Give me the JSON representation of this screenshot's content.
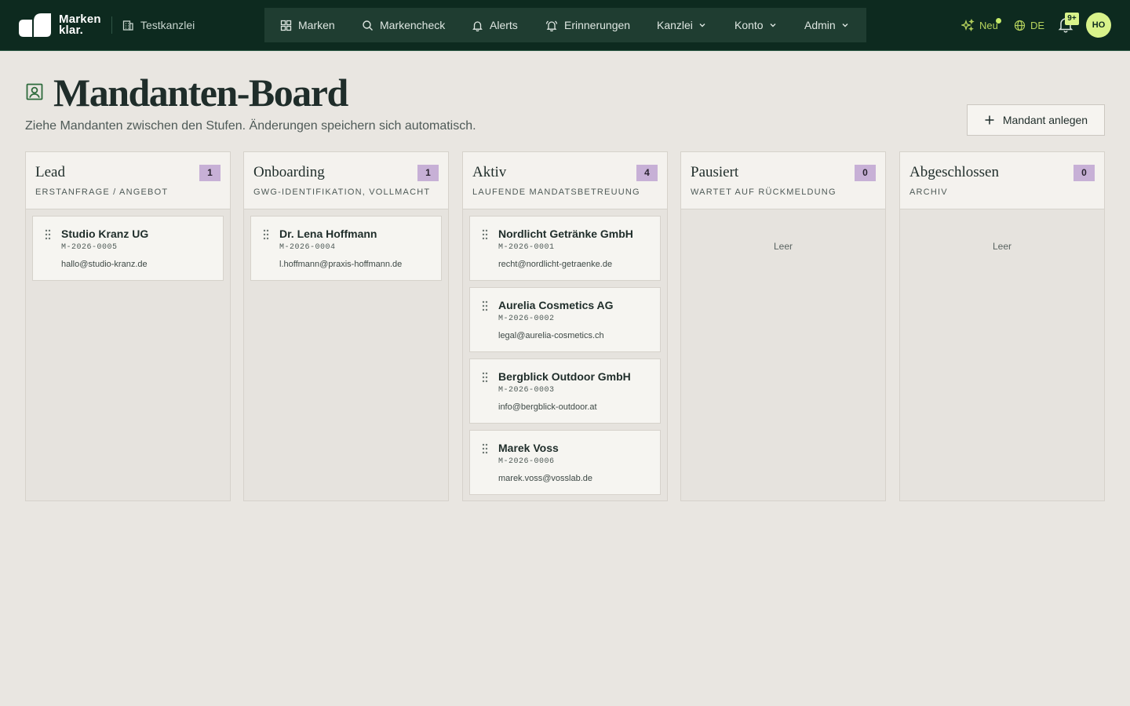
{
  "app": {
    "logo_line1": "Marken",
    "logo_line2": "klar.",
    "tenant": "Testkanzlei"
  },
  "nav": {
    "items": [
      {
        "label": "Marken",
        "icon": "grid-icon"
      },
      {
        "label": "Markencheck",
        "icon": "search-icon"
      },
      {
        "label": "Alerts",
        "icon": "bell-icon"
      },
      {
        "label": "Erinnerungen",
        "icon": "bell-ring-icon"
      },
      {
        "label": "Kanzlei",
        "icon": "chevron-down-icon"
      },
      {
        "label": "Konto",
        "icon": "chevron-down-icon"
      },
      {
        "label": "Admin",
        "icon": "chevron-down-icon"
      }
    ]
  },
  "topbar": {
    "new_label": "Neu",
    "lang_label": "DE",
    "notifications_badge": "9+",
    "avatar_initials": "HO"
  },
  "page": {
    "title": "Mandanten-Board",
    "subtitle": "Ziehe Mandanten zwischen den Stufen. Änderungen speichern sich automatisch.",
    "add_button": "Mandant anlegen"
  },
  "board": {
    "columns": [
      {
        "title": "Lead",
        "subtitle": "Erstanfrage / Angebot",
        "count": "1",
        "empty_label": "",
        "cards": [
          {
            "name": "Studio Kranz UG",
            "code": "M-2026-0005",
            "email": "hallo@studio-kranz.de"
          }
        ]
      },
      {
        "title": "Onboarding",
        "subtitle": "GwG-Identifikation, Vollmacht",
        "count": "1",
        "empty_label": "",
        "cards": [
          {
            "name": "Dr. Lena Hoffmann",
            "code": "M-2026-0004",
            "email": "l.hoffmann@praxis-hoffmann.de"
          }
        ]
      },
      {
        "title": "Aktiv",
        "subtitle": "Laufende Mandatsbetreuung",
        "count": "4",
        "empty_label": "",
        "cards": [
          {
            "name": "Nordlicht Getränke GmbH",
            "code": "M-2026-0001",
            "email": "recht@nordlicht-getraenke.de"
          },
          {
            "name": "Aurelia Cosmetics AG",
            "code": "M-2026-0002",
            "email": "legal@aurelia-cosmetics.ch"
          },
          {
            "name": "Bergblick Outdoor GmbH",
            "code": "M-2026-0003",
            "email": "info@bergblick-outdoor.at"
          },
          {
            "name": "Marek Voss",
            "code": "M-2026-0006",
            "email": "marek.voss@vosslab.de"
          }
        ]
      },
      {
        "title": "Pausiert",
        "subtitle": "Wartet auf Rückmeldung",
        "count": "0",
        "empty_label": "Leer",
        "cards": []
      },
      {
        "title": "Abgeschlossen",
        "subtitle": "Archiv",
        "count": "0",
        "empty_label": "Leer",
        "cards": []
      }
    ]
  },
  "colors": {
    "topbar_bg": "#0d2a1f",
    "nav_bg": "#1f3d31",
    "accent_lime": "#d8f28a",
    "count_badge": "#c7b0d6",
    "page_bg": "#e9e6e1"
  }
}
